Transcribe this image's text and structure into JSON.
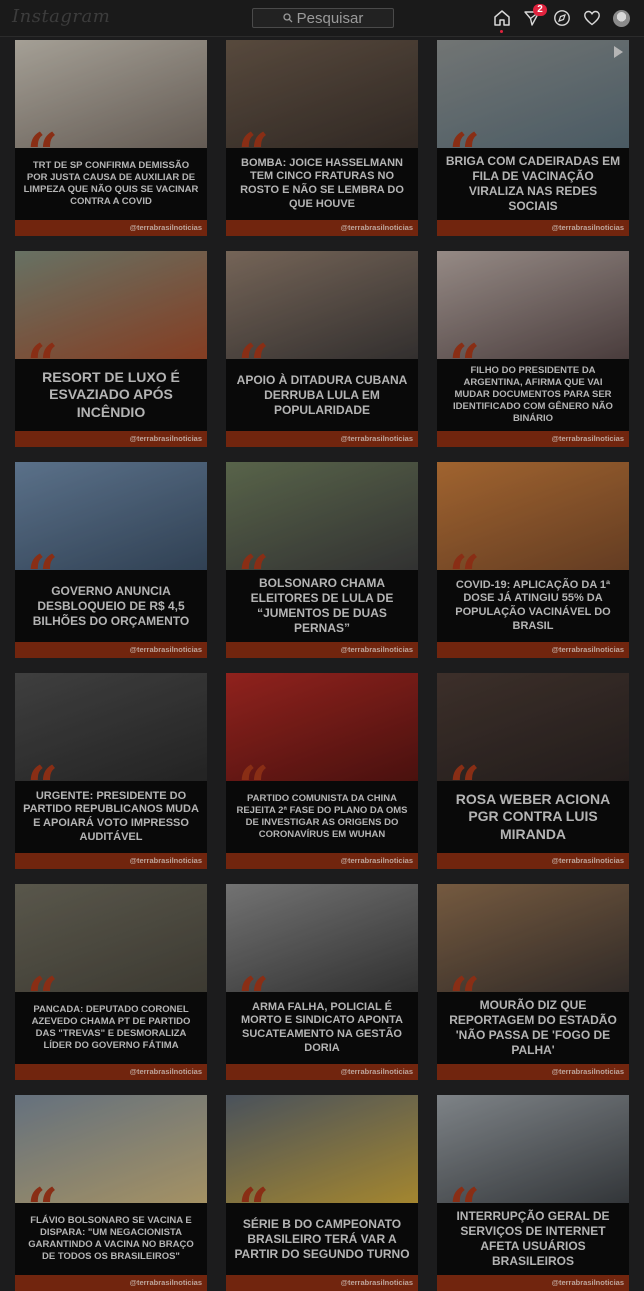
{
  "app": {
    "logo_text": "Instagram"
  },
  "search": {
    "placeholder": "Pesquisar"
  },
  "nav": {
    "notifications_badge": "2"
  },
  "handle": "@terrabrasilnoticias",
  "posts": [
    {
      "caption": "TRT de SP confirma demissão por justa causa de auxiliar de limpeza que não quis se vacinar contra a Covid",
      "img": "vaccine-arm",
      "palette": [
        "#c9c3b7",
        "#7a6f66"
      ]
    },
    {
      "caption": "Bomba: Joice Hasselmann tem cinco fraturas no rosto e não se lembra do que houve",
      "img": "woman-portrait",
      "palette": [
        "#6b5a4b",
        "#3b312b"
      ]
    },
    {
      "caption": "Briga com cadeiradas em fila de vacinação viraliza nas redes sociais",
      "img": "fight-scene",
      "palette": [
        "#8b8f8e",
        "#5b6f7a"
      ]
    },
    {
      "caption": "Resort de luxo é esvaziado após incêndio",
      "img": "resort-fire",
      "palette": [
        "#7e8b7a",
        "#a24b2a"
      ]
    },
    {
      "caption": "Apoio à ditadura cubana derruba Lula em popularidade",
      "img": "man-portrait",
      "palette": [
        "#8f7b6b",
        "#3e3a39"
      ]
    },
    {
      "caption": "Filho do presidente da Argentina, afirma que vai mudar documentos para ser identificado com gênero não binário",
      "img": "blonde-portrait",
      "palette": [
        "#b7a9a3",
        "#5a4a4a"
      ]
    },
    {
      "caption": "Governo anuncia desbloqueio de R$ 4,5 bilhões do orçamento",
      "img": "ministry-building",
      "palette": [
        "#6f8aa8",
        "#3b4f66"
      ]
    },
    {
      "caption": "Bolsonaro chama eleitores de Lula de “jumentos de duas pernas”",
      "img": "man-smiling",
      "palette": [
        "#6c7a5a",
        "#3d3d3d"
      ]
    },
    {
      "caption": "Covid-19: aplicação da 1ª dose já atingiu 55% da população vacinável do Brasil",
      "img": "injection",
      "palette": [
        "#c47a3a",
        "#7a4a2a"
      ]
    },
    {
      "caption": "Urgente: Presidente do Partido Republicanos muda e apoiará voto impresso auditável",
      "img": "politician-speech",
      "palette": [
        "#4d4d4d",
        "#2b2b2b"
      ]
    },
    {
      "caption": "Partido Comunista da China rejeita 2ª fase do plano da OMS de investigar as origens do coronavírus em Wuhan",
      "img": "flags-leader",
      "palette": [
        "#b02a24",
        "#5a1512"
      ]
    },
    {
      "caption": "Rosa Weber aciona PGR contra Luis Miranda",
      "img": "judge-portrait",
      "palette": [
        "#4a3a33",
        "#2a2322"
      ]
    },
    {
      "caption": "Pancada: Deputado Coronel Azevedo chama PT de partido das \"trevas\" e desmoraliza líder do governo Fátima",
      "img": "assembly-hall",
      "palette": [
        "#6d6a5c",
        "#4a473d"
      ]
    },
    {
      "caption": "Arma falha, policial é morto e sindicato aponta sucateamento na gestão Doria",
      "img": "gun",
      "palette": [
        "#8c8c8c",
        "#3c3c3c"
      ]
    },
    {
      "caption": "Mourão diz que reportagem do Estadão 'não passa de 'fogo de palha'",
      "img": "wood-wall",
      "palette": [
        "#8f6e4e",
        "#3c3430"
      ]
    },
    {
      "caption": "Flávio Bolsonaro se vacina e dispara: \"Um negacionista garantindo a vacina no braço de todos os brasileiros\"",
      "img": "vaccination-photo",
      "palette": [
        "#7b8a9a",
        "#c9b27a"
      ]
    },
    {
      "caption": "Série B do Campeonato Brasileiro terá VAR a partir do segundo turno",
      "img": "var-screen",
      "palette": [
        "#5a6470",
        "#c8a43a"
      ]
    },
    {
      "caption": "Interrupção geral de serviços de internet afeta usuários brasileiros",
      "img": "laptop",
      "palette": [
        "#9aa0a5",
        "#3e4246"
      ]
    }
  ]
}
